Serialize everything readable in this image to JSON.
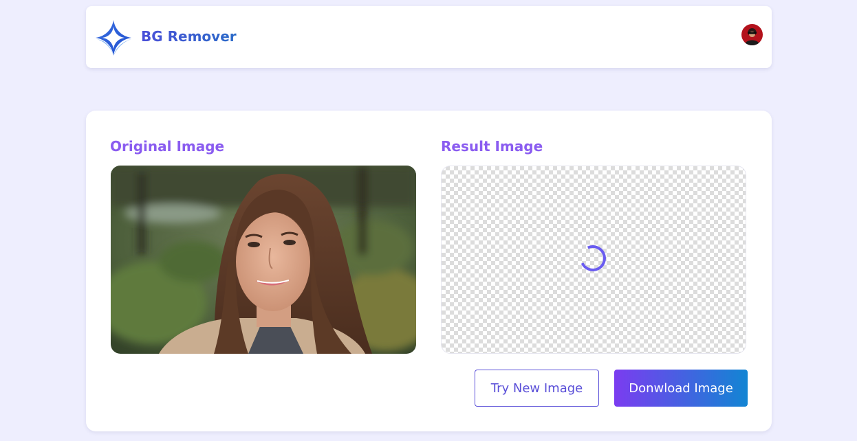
{
  "header": {
    "brand": "BG Remover",
    "logo_icon": "sparkle-star-logo-icon",
    "avatar_icon": "user-avatar-icon"
  },
  "main": {
    "original_title": "Original Image",
    "result_title": "Result Image",
    "result_state_icon": "loading-spinner-icon",
    "buttons": {
      "try_new": "Try New Image",
      "download": "Donwload Image"
    }
  },
  "colors": {
    "background": "#eeeefe",
    "brand_text": "#2f54c9",
    "section_title": "#8a5cf0",
    "accent": "#5a4fd8",
    "download_gradient_start": "#7b3cf0",
    "download_gradient_end": "#1285d3"
  }
}
